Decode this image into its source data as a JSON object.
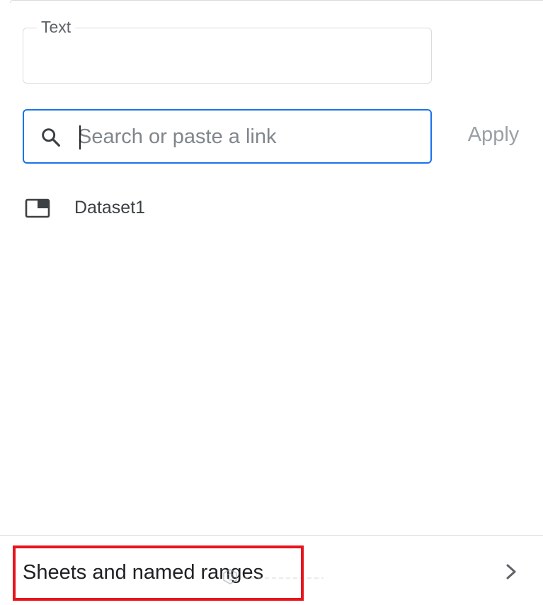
{
  "text_field": {
    "label": "Text",
    "value": ""
  },
  "search": {
    "placeholder": "Search or paste a link",
    "value": ""
  },
  "apply_button": {
    "label": "Apply"
  },
  "datasets": [
    {
      "label": "Dataset1",
      "icon": "table-icon"
    }
  ],
  "footer": {
    "sheets_label": "Sheets and named ranges",
    "chevron_icon": "chevron-right-icon"
  },
  "colors": {
    "accent": "#1a73e8",
    "highlight": "#e8141c",
    "border": "#dadce0",
    "disabled_text": "#9aa0a6"
  }
}
